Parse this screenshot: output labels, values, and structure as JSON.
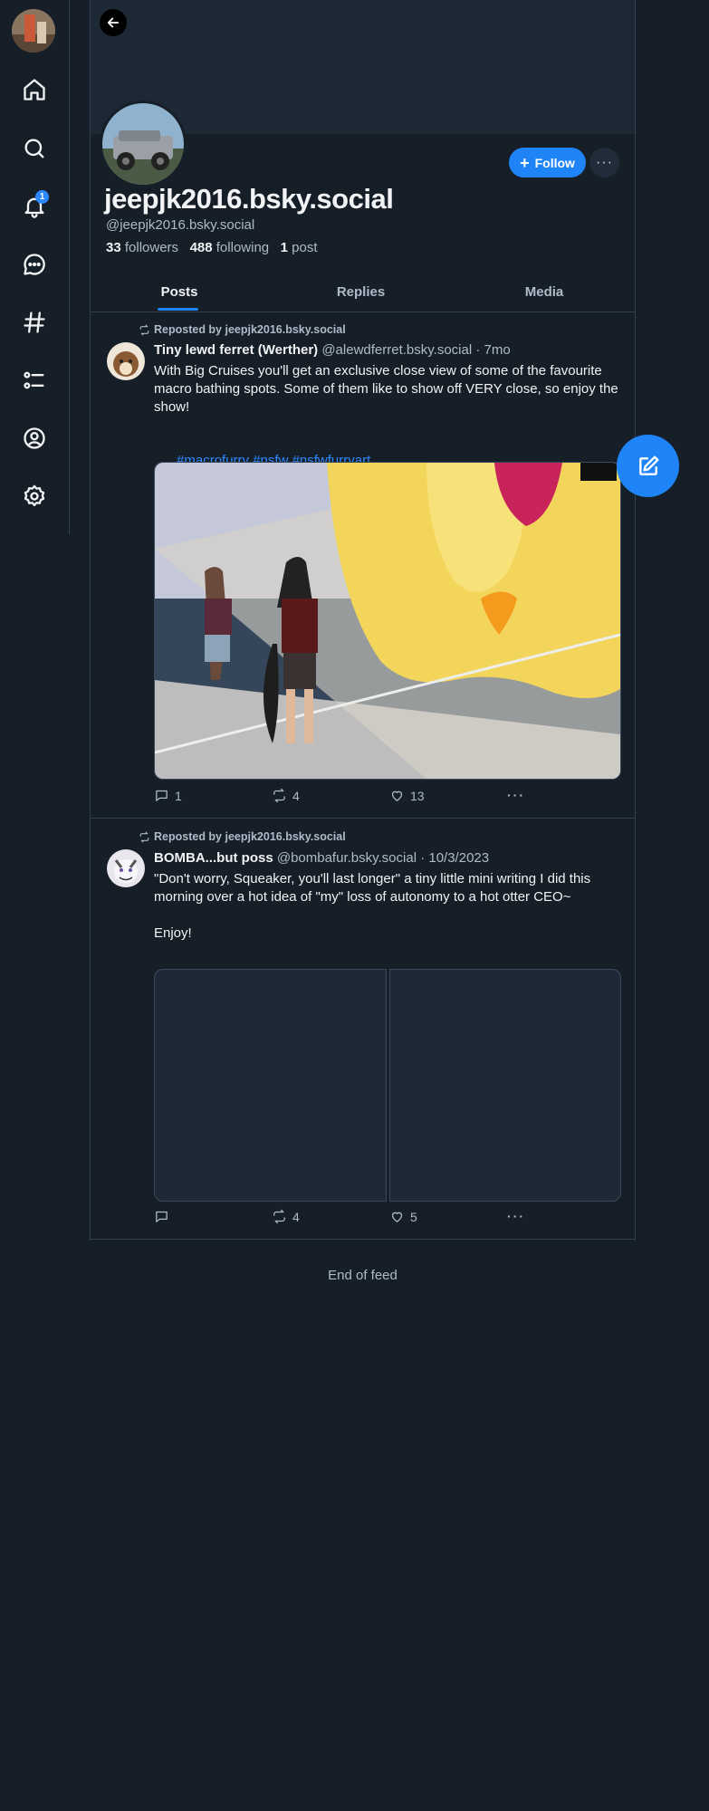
{
  "sidebar": {
    "avatar_icon": "user-avatar",
    "items": [
      {
        "name": "home",
        "icon": "home-icon"
      },
      {
        "name": "search",
        "icon": "search-icon"
      },
      {
        "name": "notifications",
        "icon": "bell-icon",
        "badge": "1"
      },
      {
        "name": "chat",
        "icon": "chat-bubble-icon"
      },
      {
        "name": "feeds",
        "icon": "hashtag-icon"
      },
      {
        "name": "lists",
        "icon": "list-icon"
      },
      {
        "name": "profile",
        "icon": "user-circle-icon"
      },
      {
        "name": "settings",
        "icon": "gear-icon"
      }
    ]
  },
  "profile": {
    "display_name": "jeepjk2016.bsky.social",
    "handle": "@jeepjk2016.bsky.social",
    "followers_count": "33",
    "followers_label": "followers",
    "following_count": "488",
    "following_label": "following",
    "posts_count": "1",
    "posts_label": "post",
    "follow_label": "Follow",
    "more_label": "···"
  },
  "tabs": [
    "Posts",
    "Replies",
    "Media"
  ],
  "posts": [
    {
      "repost_label": "Reposted by jeepjk2016.bsky.social",
      "author_name": "Tiny lewd ferret (Werther)",
      "author_handle": "@alewdferret.bsky.social",
      "time": "· 7mo",
      "text": "With Big Cruises you'll get an exclusive close view of some of the favourite macro bathing spots. Some of them like to show off VERY close, so enjoy the show!",
      "hashtags": [
        "#macrofurry",
        "#nsfw",
        "#nsfwfurryart"
      ],
      "replies": "1",
      "reposts": "4",
      "likes": "13"
    },
    {
      "repost_label": "Reposted by jeepjk2016.bsky.social",
      "author_name": "BOMBA...but poss",
      "author_handle": "@bombafur.bsky.social",
      "time": "· 10/3/2023",
      "text": "\"Don't worry, Squeaker, you'll last longer\" a tiny little mini writing I did this morning over a hot idea of \"my\" loss of autonomy to a hot otter CEO~\n\nEnjoy!",
      "replies": "",
      "reposts": "4",
      "likes": "5"
    }
  ],
  "feed_end": "End of feed",
  "colors": {
    "accent": "#1f84f7",
    "background": "#161e27",
    "border": "#2e4052",
    "muted_text": "#aebbc9"
  }
}
